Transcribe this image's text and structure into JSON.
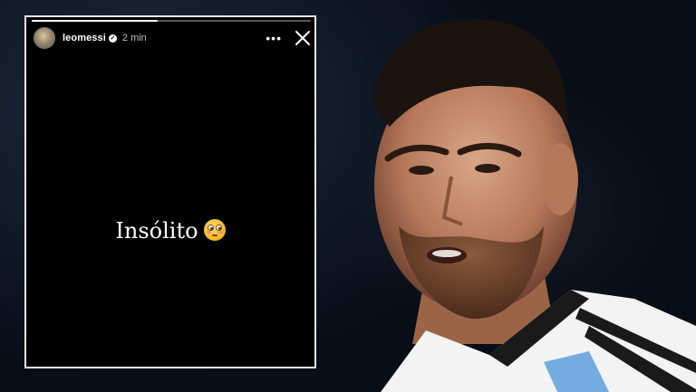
{
  "story": {
    "username": "leomessi",
    "time": "2 min",
    "progress": 0.45,
    "caption": "Insólito",
    "emoji": "flushed-face-emoji"
  },
  "icons": {
    "more": "more-horizontal-icon",
    "close": "close-icon",
    "verified": "verified-badge-icon"
  },
  "colors": {
    "story_bg": "#000000",
    "frame_border": "#e9e9e9",
    "jersey_stripe": "#74acdf"
  }
}
